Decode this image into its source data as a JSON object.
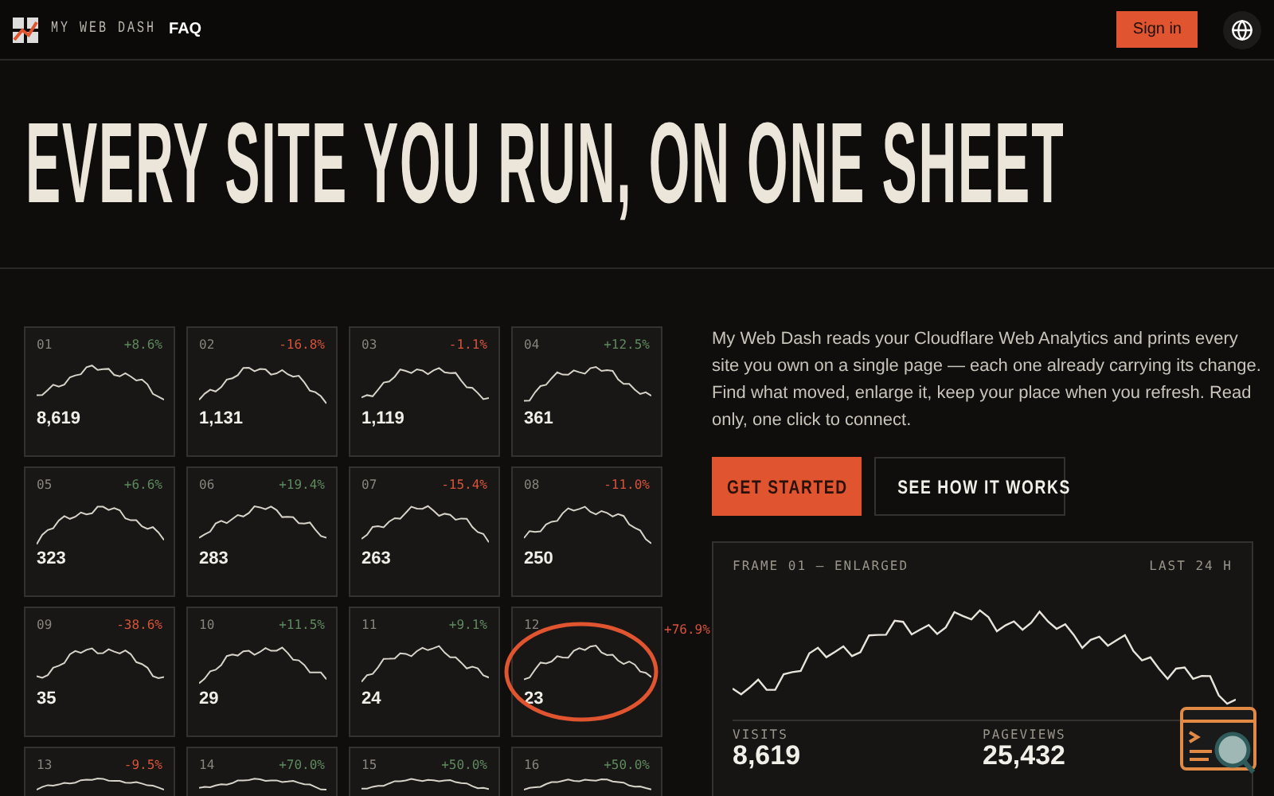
{
  "nav": {
    "brand": "MY WEB DASH",
    "links": [
      "FAQ"
    ],
    "sign_in": "Sign in"
  },
  "hero": {
    "title": "EVERY SITE YOU RUN, ON ONE SHEET"
  },
  "sites": [
    {
      "number": "01",
      "change": "+8.6%",
      "color": "#5f8a5f",
      "value": "8,619"
    },
    {
      "number": "02",
      "change": "-16.8%",
      "color": "#d8533a",
      "value": "1,131"
    },
    {
      "number": "03",
      "change": "-1.1%",
      "color": "#d8533a",
      "value": "1,119"
    },
    {
      "number": "04",
      "change": "+12.5%",
      "color": "#5f8a5f",
      "value": "361"
    },
    {
      "number": "05",
      "change": "+6.6%",
      "color": "#5f8a5f",
      "value": "323"
    },
    {
      "number": "06",
      "change": "+19.4%",
      "color": "#5f8a5f",
      "value": "283"
    },
    {
      "number": "07",
      "change": "-15.4%",
      "color": "#d8533a",
      "value": "263"
    },
    {
      "number": "08",
      "change": "-11.0%",
      "color": "#d8533a",
      "value": "250"
    },
    {
      "number": "09",
      "change": "-38.6%",
      "color": "#d8533a",
      "value": "35"
    },
    {
      "number": "10",
      "change": "+11.5%",
      "color": "#5f8a5f",
      "value": "29"
    },
    {
      "number": "11",
      "change": "+9.1%",
      "color": "#5f8a5f",
      "value": "24"
    },
    {
      "number": "12",
      "change": "+76.9%",
      "color": "#d8533a",
      "value": "23",
      "circled": true
    },
    {
      "number": "13",
      "change": "-9.5%",
      "color": "#d8533a"
    },
    {
      "number": "14",
      "change": "+70.0%",
      "color": "#5f8a5f"
    },
    {
      "number": "15",
      "change": "+50.0%",
      "color": "#5f8a5f"
    },
    {
      "number": "16",
      "change": "+50.0%",
      "color": "#5f8a5f"
    }
  ],
  "intro": "My Web Dash reads your Cloudflare Web Analytics and prints every site you own on a single page — each one already carrying its change. Find what moved, enlarge it, keep your place when you refresh. Read only, one click to connect.",
  "buttons": {
    "primary": "GET STARTED",
    "secondary": "SEE HOW IT WORKS"
  },
  "frame": {
    "title": "FRAME 01 — ENLARGED",
    "range": "LAST 24 H",
    "stats": [
      {
        "label": "VISITS",
        "value": "8,619"
      },
      {
        "label": "PAGEVIEWS",
        "value": "25,432"
      }
    ]
  }
}
